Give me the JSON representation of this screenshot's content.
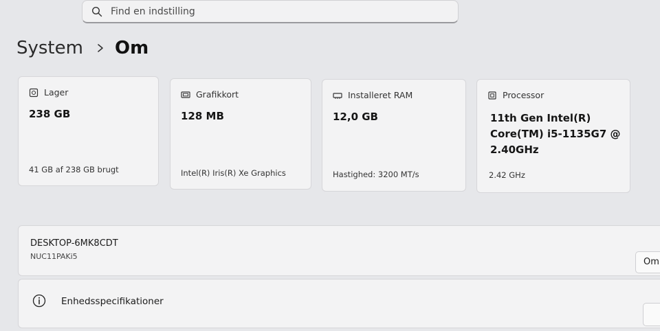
{
  "search": {
    "placeholder": "Find en indstilling"
  },
  "breadcrumb": {
    "parent": "System",
    "current": "Om"
  },
  "cards": [
    {
      "label": "Lager",
      "value": "238 GB",
      "footer": "41 GB af 238 GB brugt",
      "icon": "storage-icon"
    },
    {
      "label": "Grafikkort",
      "value": "128 MB",
      "footer": "Intel(R) Iris(R) Xe Graphics",
      "icon": "graphics-card-icon"
    },
    {
      "label": "Installeret RAM",
      "value": "12,0 GB",
      "footer": "Hastighed: 3200 MT/s",
      "icon": "ram-icon"
    },
    {
      "label": "Processor",
      "value_lines": [
        "11th Gen Intel(R)",
        "Core(TM) i5-1135G7 @",
        "2.40GHz"
      ],
      "footer": "2.42 GHz",
      "icon": "processor-icon"
    }
  ],
  "device": {
    "name": "DESKTOP-6MK8CDT",
    "model": "NUC11PAKi5",
    "rename_button": "Om"
  },
  "specs": {
    "label": "Enhedsspecifikationer",
    "icon": "info-icon"
  }
}
